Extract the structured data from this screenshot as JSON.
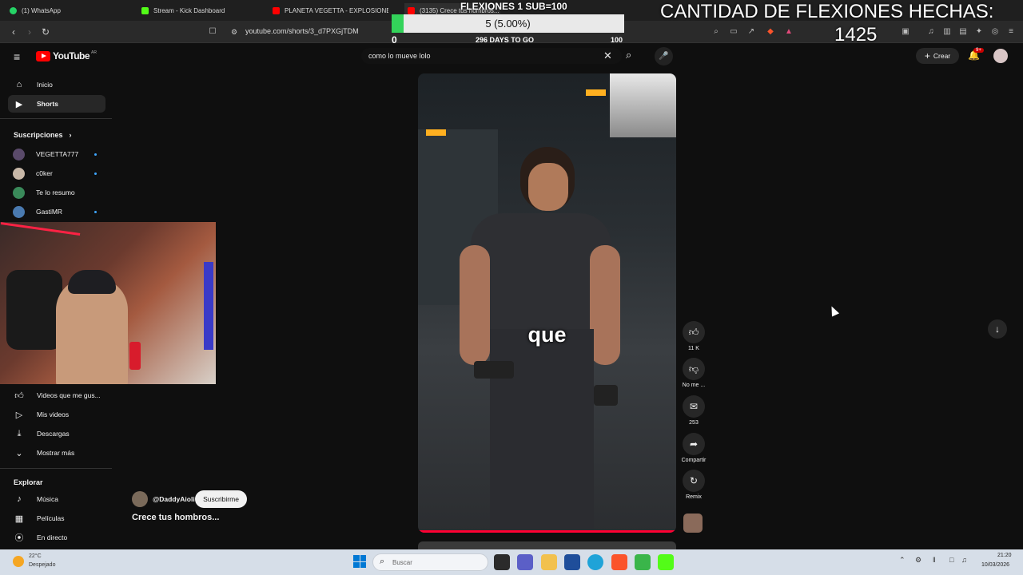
{
  "browser": {
    "tabs": [
      {
        "label": "(1) WhatsApp",
        "color": "#25d366"
      },
      {
        "label": "Stream - Kick Dashboard",
        "color": "#53fc18"
      },
      {
        "label": "PLANETA VEGETTA - EXPLOSIONES I",
        "color": "#ff0000"
      },
      {
        "label": "(3135) Crece tus hombros...",
        "color": "#ff0000"
      }
    ],
    "url": "youtube.com/shorts/3_d7PXGjTDM"
  },
  "overlay": {
    "goal_title": "FLEXIONES 1 SUB=100",
    "goal_value": "5 (5.00%)",
    "goal_progress": 0.05,
    "goal_min": "0",
    "goal_max": "100",
    "days_left": "296 DAYS TO GO",
    "counter_title": "CANTIDAD DE FLEXIONES HECHAS:",
    "counter_value": "1425"
  },
  "youtube": {
    "logo": "YouTube",
    "region": "AR",
    "search_query": "como lo mueve lolo",
    "create_label": "Crear",
    "notif_badge": "9+",
    "sidebar": {
      "home": "Inicio",
      "shorts": "Shorts",
      "subs_header": "Suscripciones",
      "subscriptions": [
        "VEGETTA777",
        "c0ker",
        "Te lo resumo",
        "GastiMR"
      ],
      "you_items": [
        "Videos que me gus...",
        "Mis videos",
        "Descargas",
        "Mostrar más"
      ],
      "explore_header": "Explorar",
      "explore_items": [
        "Música",
        "Películas",
        "En directo"
      ]
    },
    "short": {
      "subtitle": "que",
      "channel": "@DaddyAioli",
      "subscribe_label": "Suscribirme",
      "title": "Crece tus hombros...",
      "likes": "11 K",
      "dislike_label": "No me ...",
      "comments": "253",
      "share_label": "Compartir",
      "remix_label": "Remix"
    }
  },
  "taskbar": {
    "weather_temp": "22°C",
    "weather_desc": "Despejado",
    "search_placeholder": "Buscar",
    "time": "21:20",
    "date": "10/03/2026"
  }
}
